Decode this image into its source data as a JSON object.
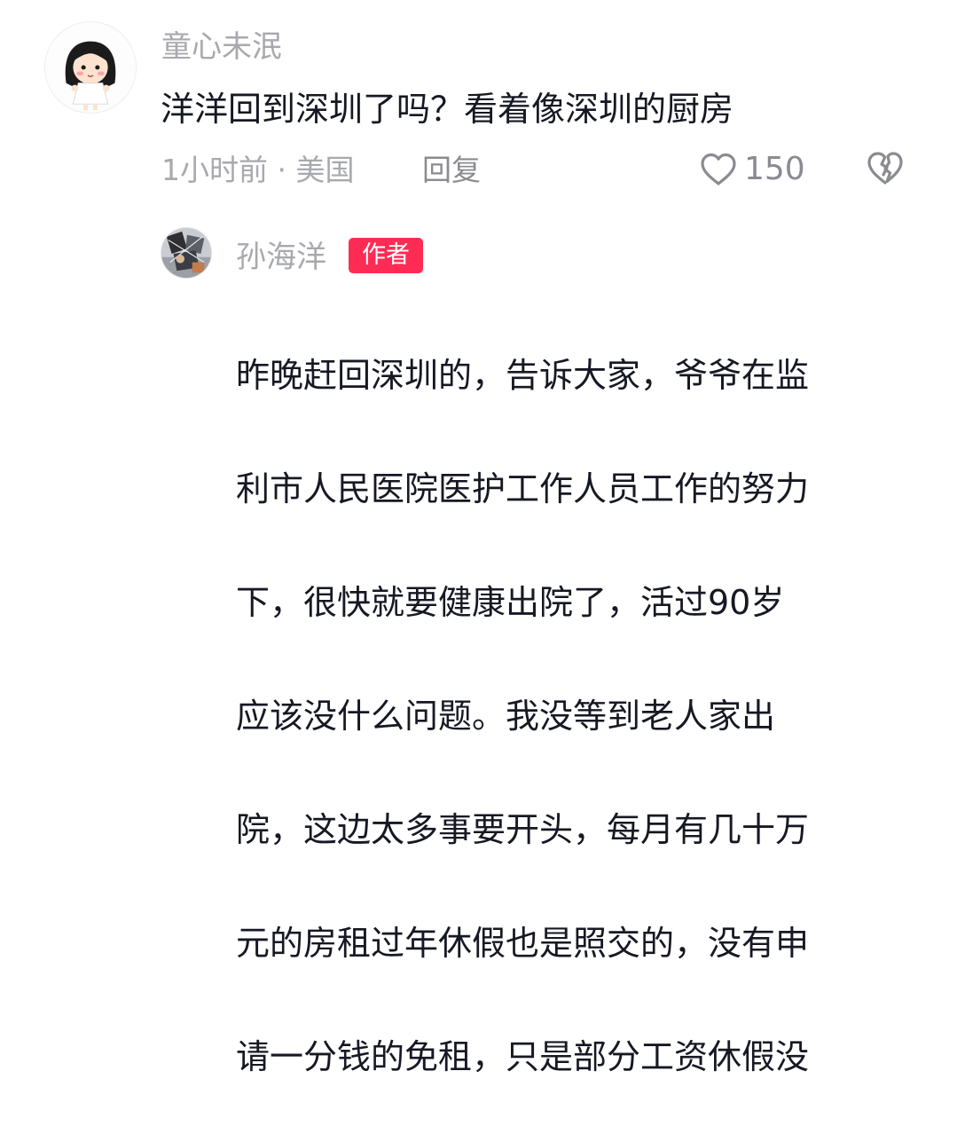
{
  "comment": {
    "avatar_icon": "user-avatar-cartoon-girl",
    "username": "童心未泯",
    "text": "洋洋回到深圳了吗？看着像深圳的厨房",
    "time_location": "1小时前 · 美国",
    "reply_label": "回复",
    "like_icon": "heart-outline-icon",
    "like_count": "150",
    "dislike_icon": "broken-heart-icon"
  },
  "reply": {
    "avatar_icon": "user-avatar-photo",
    "username": "孙海洋",
    "author_badge": "作者",
    "badge_color": "#fe2c55",
    "lines": [
      "昨晚赶回深圳的，告诉大家，爷爷在监",
      "利市人民医院医护工作人员工作的努力",
      "下，很快就要健康出院了，活过90岁",
      "应该没什么问题。我没等到老人家出",
      "院，这边太多事要开头，每月有几十万",
      "元的房租过年休假也是照交的，没有申",
      "请一分钱的免租，只是部分工资休假没"
    ]
  }
}
